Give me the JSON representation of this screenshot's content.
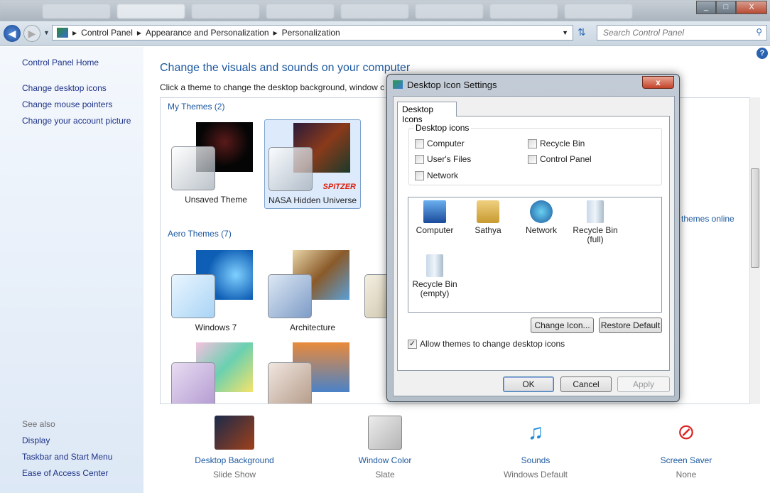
{
  "window": {
    "minimize": "_",
    "maximize": "□",
    "close": "X"
  },
  "address": {
    "crumbs": [
      "Control Panel",
      "Appearance and Personalization",
      "Personalization"
    ],
    "search_placeholder": "Search Control Panel"
  },
  "sidebar": {
    "home": "Control Panel Home",
    "links": [
      "Change desktop icons",
      "Change mouse pointers",
      "Change your account picture"
    ],
    "see_also": "See also",
    "see_also_links": [
      "Display",
      "Taskbar and Start Menu",
      "Ease of Access Center"
    ]
  },
  "main": {
    "title": "Change the visuals and sounds on your computer",
    "subtitle": "Click a theme to change the desktop background, window c",
    "my_themes": "My Themes (2)",
    "aero_themes": "Aero Themes (7)",
    "get_more": "themes online",
    "themes_mine": [
      "Unsaved Theme",
      "NASA Hidden Universe"
    ],
    "spitzer": "SPITZER",
    "themes_aero": [
      "Windows 7",
      "Architecture"
    ]
  },
  "bottom": [
    {
      "label": "Desktop Background",
      "sub": "Slide Show"
    },
    {
      "label": "Window Color",
      "sub": "Slate"
    },
    {
      "label": "Sounds",
      "sub": "Windows Default"
    },
    {
      "label": "Screen Saver",
      "sub": "None"
    }
  ],
  "dialog": {
    "title": "Desktop Icon Settings",
    "close": "x",
    "tab": "Desktop Icons",
    "group": "Desktop icons",
    "checks": [
      {
        "label": "Computer",
        "checked": false
      },
      {
        "label": "User's Files",
        "checked": false
      },
      {
        "label": "Network",
        "checked": false
      },
      {
        "label": "Recycle Bin",
        "checked": false
      },
      {
        "label": "Control Panel",
        "checked": false
      }
    ],
    "icons": [
      {
        "label": "Computer"
      },
      {
        "label": "Sathya"
      },
      {
        "label": "Network"
      },
      {
        "label": "Recycle Bin (full)"
      },
      {
        "label": "Recycle Bin (empty)"
      }
    ],
    "change_icon": "Change Icon...",
    "restore": "Restore Default",
    "allow": "Allow themes to change desktop icons",
    "allow_checked": "✓",
    "ok": "OK",
    "cancel": "Cancel",
    "apply": "Apply"
  }
}
